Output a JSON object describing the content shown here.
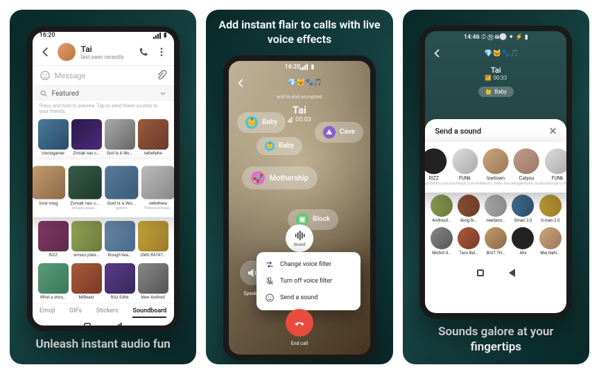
{
  "panel1": {
    "caption": "Unleash instant audio fun",
    "status_time": "16:20",
    "chat_name": "Tai",
    "chat_sub": "last seen recently",
    "msg_placeholder": "Message",
    "featured_label": "Featured",
    "hint": "Press and hold to preview. Tap to send these sounds to your friends.",
    "tabs": [
      "Emoji",
      "GIFs",
      "Stickers",
      "Soundboard"
    ],
    "row1": [
      {
        "name": "ciociogamer",
        "sub": ""
      },
      {
        "name": "Zvniak nao c...",
        "sub": ""
      },
      {
        "name": "God Is A Wo...",
        "sub": ""
      },
      {
        "name": "nehehehe",
        "sub": ""
      }
    ],
    "row_pop": [
      {
        "name": "love msg",
        "sub": ""
      },
      {
        "name": "Zvniak nao c...",
        "sub": "emasir-palan..."
      },
      {
        "name": "God Is a Wo...",
        "sub": "gomot"
      },
      {
        "name": "nehehew",
        "sub": "Thevoicofnoob..."
      }
    ],
    "row2": [
      {
        "name": "RIZZ",
        "sub": ""
      },
      {
        "name": "wmour plais...",
        "sub": ""
      },
      {
        "name": "ihough hea...",
        "sub": ""
      },
      {
        "name": "OMG RATAT...",
        "sub": ""
      }
    ],
    "row3": [
      {
        "name": "What a story...",
        "sub": ""
      },
      {
        "name": "MiBeast",
        "sub": ""
      },
      {
        "name": "Rizz Edite",
        "sub": ""
      },
      {
        "name": "New Android",
        "sub": ""
      }
    ]
  },
  "panel2": {
    "title": "Add instant flair to calls with live voice effects",
    "status_time": "16:20",
    "emoji_row": "💎🐱🐾🎵",
    "encrypted": "end to end encrypted",
    "call_name": "Tai",
    "call_time": "00:03",
    "effects": {
      "baby": "Baby",
      "cave": "Cave",
      "mothership": "Mothership",
      "block": "Block"
    },
    "sound_btn": "Sound",
    "speaker": "Speaker",
    "menu": {
      "change": "Change voice filter",
      "off": "Turn off voice filter",
      "send": "Send a sound"
    },
    "end_call": "End call"
  },
  "panel3": {
    "caption": "Sounds galore at your fingertips",
    "status_time": "14:46",
    "emoji_row": "💎🐱🐾🎵",
    "call_name": "Tai",
    "call_time": "00:33",
    "baby": "Baby",
    "sheet_title": "Send a sound",
    "row_pop": [
      {
        "name": "RIZZ",
        "sub": "Expandelltho  osChannelT145"
      },
      {
        "name": "FUNk",
        "sub": "kanhing4.0  american"
      },
      {
        "name": "lowtown",
        "sub": "Meotic iteBu  binoclt"
      },
      {
        "name": "Catyou",
        "sub": "Inlugehttyho  ncali"
      },
      {
        "name": "FUNk",
        "sub": "kanhing4.0  ohhodoan"
      }
    ],
    "row2": [
      {
        "name": "Androud...",
        "sub": ""
      },
      {
        "name": "dung bi...",
        "sub": ""
      },
      {
        "name": "neeSeco...",
        "sub": ""
      },
      {
        "name": "Gmari 2.0",
        "sub": ""
      },
      {
        "name": "G-man 2.0",
        "sub": ""
      }
    ],
    "row3": [
      {
        "name": "Michol d...",
        "sub": ""
      },
      {
        "name": "Taco Bel...",
        "sub": ""
      },
      {
        "name": "BrUT TH...",
        "sub": ""
      },
      {
        "name": "Ahx",
        "sub": ""
      },
      {
        "name": "Mai Nahi...",
        "sub": ""
      }
    ]
  }
}
